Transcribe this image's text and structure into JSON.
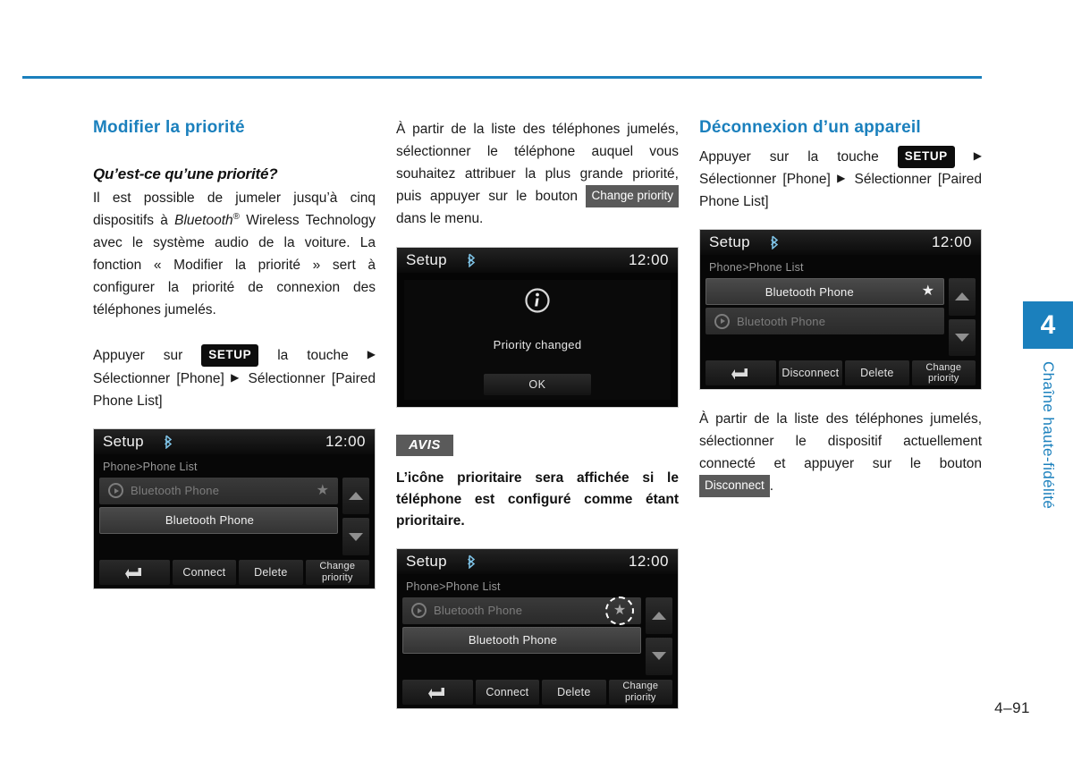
{
  "page": {
    "number": "4–91",
    "chapter_tab": {
      "number": "4",
      "label": "Chaîne haute-fidélité"
    },
    "accent_color": "#1b80bd"
  },
  "column1": {
    "section_title": "Modifier la priorité",
    "sub_title": "Qu’est-ce qu’une priorité?",
    "paragraph_part1": "Il est possible de jumeler jusqu’à cinq dispositifs à ",
    "paragraph_bluetooth": "Bluetooth",
    "paragraph_sup": "®",
    "paragraph_part2": " Wireless Technology avec le système audio de la voiture. La fonction « Modifier la priorité » sert à configurer la priorité de connexion des téléphones jumelés.",
    "instruction_part1": "Appuyer sur ",
    "instruction_key": "SETUP",
    "instruction_part2": " la touche ",
    "instruction_arrow1": "▶",
    "instruction_part3": " Sélectionner [Phone] ",
    "instruction_arrow2": "▶",
    "instruction_part4": " Sélectionner [Paired Phone List]"
  },
  "column2": {
    "paragraph_part1": "À partir de la liste des téléphones jumelés, sélectionner le téléphone auquel vous souhaitez attribuer la plus grande priorité, puis appuyer sur le bouton ",
    "paragraph_button": "Change priority",
    "paragraph_part2": " dans le menu.",
    "note_tag": "AVIS",
    "note_text": "L’icône prioritaire sera affichée si le téléphone est configuré comme étant prioritaire."
  },
  "column3": {
    "section_title": "Déconnexion d’un appareil",
    "instruction_part1": "Appuyer sur la touche ",
    "instruction_key": "SETUP",
    "instruction_arrow1": "▶",
    "instruction_part2": " Sélectionner [Phone] ",
    "instruction_arrow2": "▶",
    "instruction_part3": " Sélectionner [Paired Phone List]",
    "paragraph_part1": "À partir de la liste des téléphones jumelés, sélectionner le dispositif actuellement connecté et appuyer sur le bouton ",
    "paragraph_button": "Disconnect",
    "paragraph_part2": "."
  },
  "screens": {
    "phone_list_1": {
      "title": "Setup",
      "bluetooth_icon": "bluetooth-icon",
      "clock": "12:00",
      "breadcrumb": "Phone>Phone List",
      "rows": [
        {
          "label": "Bluetooth Phone",
          "has_play_icon": true,
          "has_star": true,
          "state": "dim"
        },
        {
          "label": "Bluetooth Phone",
          "has_play_icon": false,
          "has_star": false,
          "state": "bright"
        }
      ],
      "scroll_up": "scroll-up-arrow",
      "scroll_down": "scroll-down-arrow",
      "buttons": [
        "back-arrow-icon",
        "Connect",
        "Delete",
        "Change priority"
      ]
    },
    "priority_changed": {
      "title": "Setup",
      "bluetooth_icon": "bluetooth-icon",
      "clock": "12:00",
      "info_icon": "info-icon",
      "message": "Priority changed",
      "ok_label": "OK"
    },
    "phone_list_2": {
      "title": "Setup",
      "bluetooth_icon": "bluetooth-icon",
      "clock": "12:00",
      "breadcrumb": "Phone>Phone List",
      "rows": [
        {
          "label": "Bluetooth Phone",
          "has_play_icon": true,
          "has_star": true,
          "star_highlighted": true,
          "state": "dim"
        },
        {
          "label": "Bluetooth Phone",
          "has_play_icon": false,
          "has_star": false,
          "state": "bright"
        }
      ],
      "scroll_up": "scroll-up-arrow",
      "scroll_down": "scroll-down-arrow",
      "buttons": [
        "back-arrow-icon",
        "Connect",
        "Delete",
        "Change priority"
      ]
    },
    "phone_list_3": {
      "title": "Setup",
      "bluetooth_icon": "bluetooth-icon",
      "clock": "12:00",
      "breadcrumb": "Phone>Phone List",
      "rows": [
        {
          "label": "Bluetooth Phone",
          "has_play_icon": false,
          "has_star": true,
          "state": "bright"
        },
        {
          "label": "Bluetooth Phone",
          "has_play_icon": true,
          "has_star": false,
          "state": "dim"
        }
      ],
      "scroll_up": "scroll-up-arrow",
      "scroll_down": "scroll-down-arrow",
      "buttons": [
        "back-arrow-icon",
        "Disconnect",
        "Delete",
        "Change priority"
      ]
    }
  }
}
